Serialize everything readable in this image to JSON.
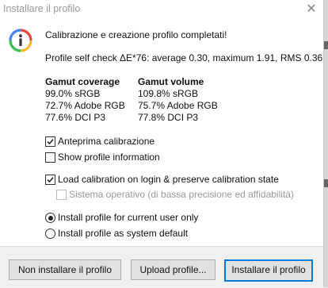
{
  "window": {
    "title": "Installare il profilo",
    "close_glyph": "✕"
  },
  "icons": {
    "info": "info-icon",
    "close": "close-icon",
    "check": "check-icon"
  },
  "colors": {
    "accent": "#0078d7",
    "info_ring": [
      "#e8453c",
      "#f9bb2d",
      "#3cba54",
      "#4285f4"
    ]
  },
  "message": {
    "headline": "Calibrazione e creazione profilo completati!",
    "self_check": "Profile self check ΔE*76: average 0.30, maximum 1.91, RMS 0.36"
  },
  "gamut": {
    "coverage_header": "Gamut coverage",
    "volume_header": "Gamut volume",
    "coverage": [
      "99.0% sRGB",
      "72.7% Adobe RGB",
      "77.6% DCI P3"
    ],
    "volume": [
      "109.8% sRGB",
      "75.7% Adobe RGB",
      "77.8% DCI P3"
    ]
  },
  "options": {
    "preview_calibration": {
      "label": "Anteprima calibrazione",
      "checked": true
    },
    "show_profile_info": {
      "label": "Show profile information",
      "checked": false
    },
    "load_calibration": {
      "label": "Load calibration on login & preserve calibration state",
      "checked": true
    },
    "os_option": {
      "label": "Sistema operativo (di bassa precisione ed affidabilità)",
      "checked": false,
      "enabled": false
    }
  },
  "install_scope": {
    "current_user": {
      "label": "Install profile for current user only",
      "selected": true
    },
    "system_default": {
      "label": "Install profile as system default",
      "selected": false
    }
  },
  "buttons": {
    "dont_install": "Non installare il profilo",
    "upload": "Upload profile...",
    "install": "Installare il profilo"
  }
}
